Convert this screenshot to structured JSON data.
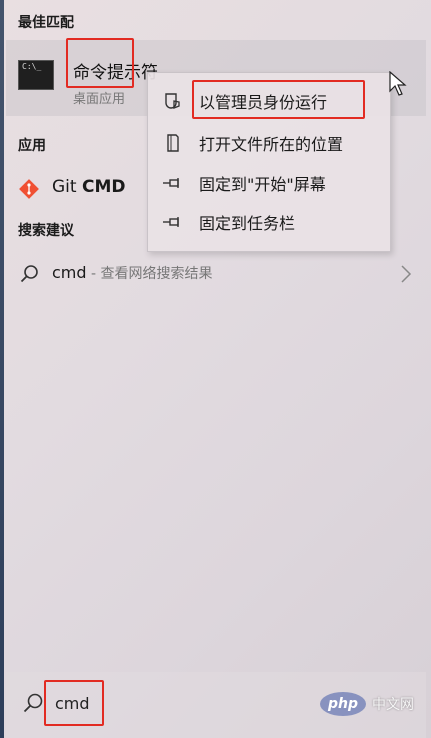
{
  "best_match": {
    "section_title": "最佳匹配",
    "app_name": "命令提示符",
    "app_type": "桌面应用",
    "icon_text": "C:\\_"
  },
  "context_menu": {
    "items": [
      {
        "label": "以管理员身份运行",
        "icon": "shield-icon"
      },
      {
        "label": "打开文件所在的位置",
        "icon": "folder-icon"
      },
      {
        "label": "固定到\"开始\"屏幕",
        "icon": "pin-icon"
      },
      {
        "label": "固定到任务栏",
        "icon": "pin-icon"
      }
    ]
  },
  "apps": {
    "section_title": "应用",
    "items": [
      {
        "label_prefix": "Git ",
        "label_bold": "CMD",
        "icon": "git-icon"
      }
    ]
  },
  "search_suggestions": {
    "section_title": "搜索建议",
    "items": [
      {
        "query": "cmd",
        "description": " - 查看网络搜索结果"
      }
    ]
  },
  "search_bar": {
    "value": "cmd"
  },
  "watermark": {
    "badge": "php",
    "text": "中文网"
  },
  "colors": {
    "highlight_box": "#e22b22",
    "git_orange": "#f05033",
    "php_purple": "#8892bf"
  }
}
